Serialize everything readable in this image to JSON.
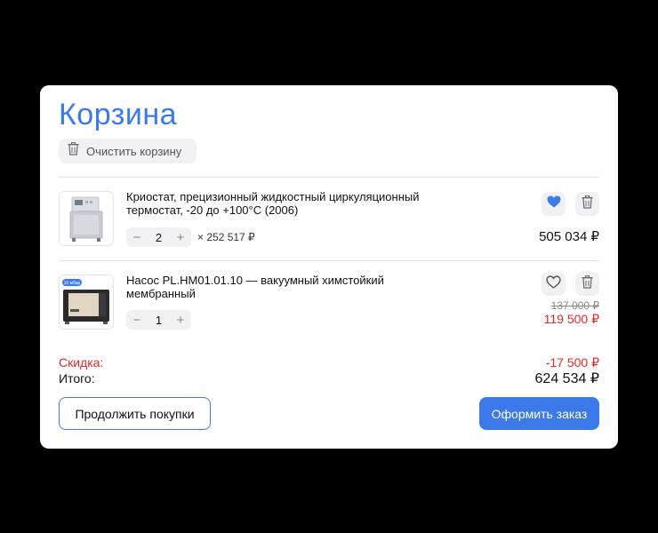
{
  "cart": {
    "title": "Корзина",
    "clear_label": "Очистить корзину",
    "items": [
      {
        "name": "Криостат, прецизионный жидкостный циркуляционный термостат, -20 до +100°C (2006)",
        "quantity": "2",
        "unit_price": "× 252 517 ₽",
        "total": "505 034 ₽",
        "favorite": true
      },
      {
        "name": "Насос PL.HM01.01.10 — вакуумный химстойкий мембранный",
        "image_badge": "10 мбар",
        "quantity": "1",
        "old_price": "137 000 ₽",
        "price": "119 500 ₽",
        "favorite": false
      }
    ],
    "summary": {
      "discount_label": "Скидка:",
      "discount_value": "-17 500 ₽",
      "total_label": "Итого:",
      "total_value": "624 534 ₽"
    },
    "continue_label": "Продолжить покупки",
    "checkout_label": "Оформить заказ"
  },
  "colors": {
    "accent": "#3b7ae8",
    "discount": "#e02828",
    "button_bg": "#f1f1f3",
    "background": "#000000",
    "card": "#ffffff"
  },
  "icons": [
    "trash-icon",
    "heart-filled-icon",
    "heart-outline-icon",
    "minus-icon",
    "plus-icon"
  ]
}
